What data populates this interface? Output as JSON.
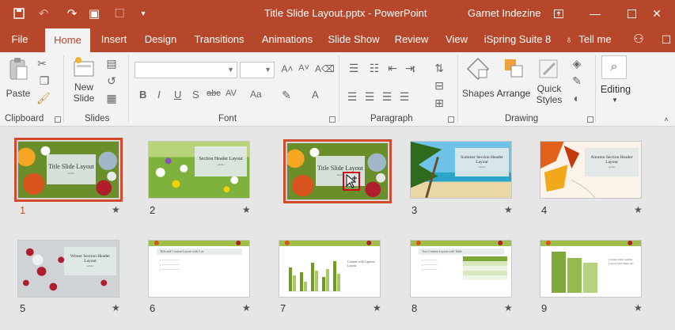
{
  "window": {
    "title": "Title Slide Layout.pptx  -  PowerPoint",
    "user": "Garnet Indezine",
    "controls": [
      "ribbon-display-icon",
      "minimize-icon",
      "maximize-icon",
      "close-icon"
    ]
  },
  "tabs": [
    "File",
    "Home",
    "Insert",
    "Design",
    "Transitions",
    "Animations",
    "Slide Show",
    "Review",
    "View",
    "iSpring Suite 8",
    "Tell me"
  ],
  "active_tab": "Home",
  "ribbon": {
    "clipboard": {
      "label": "Clipboard",
      "paste": "Paste"
    },
    "slides": {
      "label": "Slides",
      "new_slide_line1": "New",
      "new_slide_line2": "Slide"
    },
    "font": {
      "label": "Font",
      "bold": "B",
      "italic": "I",
      "underline": "U",
      "shadow": "S",
      "strike": "abc",
      "spacing": "AV",
      "case": "Aa",
      "color": "A"
    },
    "paragraph": {
      "label": "Paragraph"
    },
    "drawing": {
      "label": "Drawing",
      "shapes": "Shapes",
      "arrange": "Arrange",
      "quick_styles_line1": "Quick",
      "quick_styles_line2": "Styles"
    },
    "editing": {
      "label": "Editing"
    }
  },
  "slides": [
    {
      "number": "1",
      "title": "Title Slide Layout",
      "selected": true
    },
    {
      "number": "2",
      "title": "Section Header Layout"
    },
    {
      "number": "",
      "title": "Title Slide Layout",
      "dragging": true
    },
    {
      "number": "3",
      "title": "Summer Section Header Layout"
    },
    {
      "number": "4",
      "title": "Autumn Section Header Layout"
    },
    {
      "number": "5",
      "title": "Winter Section Header Layout"
    },
    {
      "number": "6",
      "title": "Title and Content Layout with List"
    },
    {
      "number": "7",
      "title": "Content with Caption Layout"
    },
    {
      "number": "8",
      "title": "Two Content Layout with Table"
    },
    {
      "number": "9",
      "title": "Content with Caption Layout with Smart Art"
    }
  ],
  "star_glyph": "★",
  "colors": {
    "accent": "#b7472a",
    "selection": "#d04a2b"
  }
}
